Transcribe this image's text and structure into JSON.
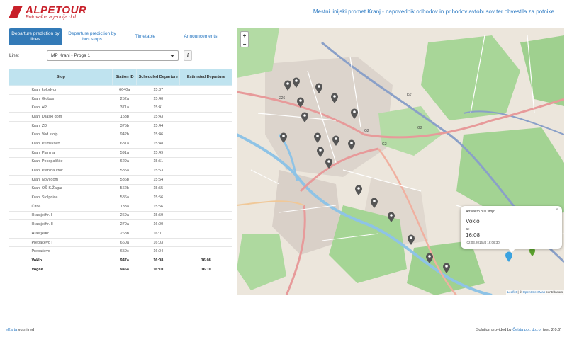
{
  "header": {
    "logo_name": "ALPETOUR",
    "logo_sub": "Potovalna agencija d.d.",
    "title": "Mestni linijski promet Kranj - napovednik odhodov in prihodov avtobusov ter obvestila za potnike"
  },
  "tabs": [
    {
      "label": "Departure prediction by lines",
      "active": true
    },
    {
      "label": "Departure prediction by bus stops",
      "active": false
    },
    {
      "label": "Timetable",
      "active": false
    },
    {
      "label": "Announcements",
      "active": false
    }
  ],
  "line": {
    "label": "Line:",
    "selected": "MP Kranj - Proga 1",
    "info_label": "i"
  },
  "table": {
    "headers": {
      "stop": "Stop",
      "station_id": "Station ID",
      "scheduled": "Scheduled Departure",
      "estimated": "Estimated Departure"
    },
    "rows": [
      {
        "stop": "Kranj kolodvor",
        "id": "6640a",
        "sched": "15:37",
        "est": ""
      },
      {
        "stop": "Kranj Globus",
        "id": "252a",
        "sched": "15:40",
        "est": ""
      },
      {
        "stop": "Kranj AP",
        "id": "371a",
        "sched": "15:41",
        "est": ""
      },
      {
        "stop": "Kranj Dijaški dom",
        "id": "153b",
        "sched": "15:43",
        "est": ""
      },
      {
        "stop": "Kranj ZD",
        "id": "375b",
        "sched": "15:44",
        "est": ""
      },
      {
        "stop": "Kranj Vod stolp",
        "id": "942b",
        "sched": "15:46",
        "est": ""
      },
      {
        "stop": "Kranj Primskovo",
        "id": "681a",
        "sched": "15:48",
        "est": ""
      },
      {
        "stop": "Kranj Planina",
        "id": "591a",
        "sched": "15:49",
        "est": ""
      },
      {
        "stop": "Kranj Pokopališče",
        "id": "629a",
        "sched": "15:51",
        "est": ""
      },
      {
        "stop": "Kranj Planina ctok",
        "id": "585a",
        "sched": "15:53",
        "est": ""
      },
      {
        "stop": "Kranj Novi dom",
        "id": "536b",
        "sched": "15:54",
        "est": ""
      },
      {
        "stop": "Kranj OŠ S.Žagar",
        "id": "562b",
        "sched": "15:55",
        "est": ""
      },
      {
        "stop": "Kranj Stolpnice",
        "id": "586a",
        "sched": "15:56",
        "est": ""
      },
      {
        "stop": "Čirče",
        "id": "133a",
        "sched": "15:56",
        "est": ""
      },
      {
        "stop": "Hrastje/Kr. I",
        "id": "269a",
        "sched": "15:59",
        "est": ""
      },
      {
        "stop": "Hrastje/Kr. II",
        "id": "270a",
        "sched": "16:00",
        "est": ""
      },
      {
        "stop": "Hrastje/Kr.",
        "id": "268b",
        "sched": "16:01",
        "est": ""
      },
      {
        "stop": "Prebačevo I",
        "id": "660a",
        "sched": "16:03",
        "est": ""
      },
      {
        "stop": "Prebačevo",
        "id": "659c",
        "sched": "16:04",
        "est": ""
      },
      {
        "stop": "Voklo",
        "id": "947a",
        "sched": "16:08",
        "est": "16:08",
        "bold": true
      },
      {
        "stop": "Vogče",
        "id": "945a",
        "sched": "16:10",
        "est": "16:10",
        "bold": true
      }
    ]
  },
  "map": {
    "zoom_in": "+",
    "zoom_out": "−",
    "popup": {
      "heading": "Arrival to bus stop:",
      "stop": "Voklo",
      "at_label": "at:",
      "time": "16:08",
      "note": "(02.03.2016 at 16:06:30)",
      "close": "×"
    },
    "attribution_leaflet": "Leaflet",
    "attribution_sep": " | © ",
    "attribution_osm": "OpenStreetMap",
    "attribution_end": " contributors",
    "road_labels": [
      "G2",
      "G2",
      "E61",
      "G2",
      "226"
    ],
    "colors": {
      "forest": "#9fd08f",
      "urban": "#dcd4cc",
      "water": "#9fcbe8",
      "highway": "#8aa0c8",
      "main_road": "#e89a9a",
      "pin": "#555555",
      "bus": "#3ba3e0"
    }
  },
  "footer": {
    "left_link": "eKarta",
    "left_text": " vozni red",
    "right_text": "Solution provided by ",
    "right_link": "Četrta pot, d.o.o.",
    "right_version": " (ver. 2.0.6)"
  }
}
